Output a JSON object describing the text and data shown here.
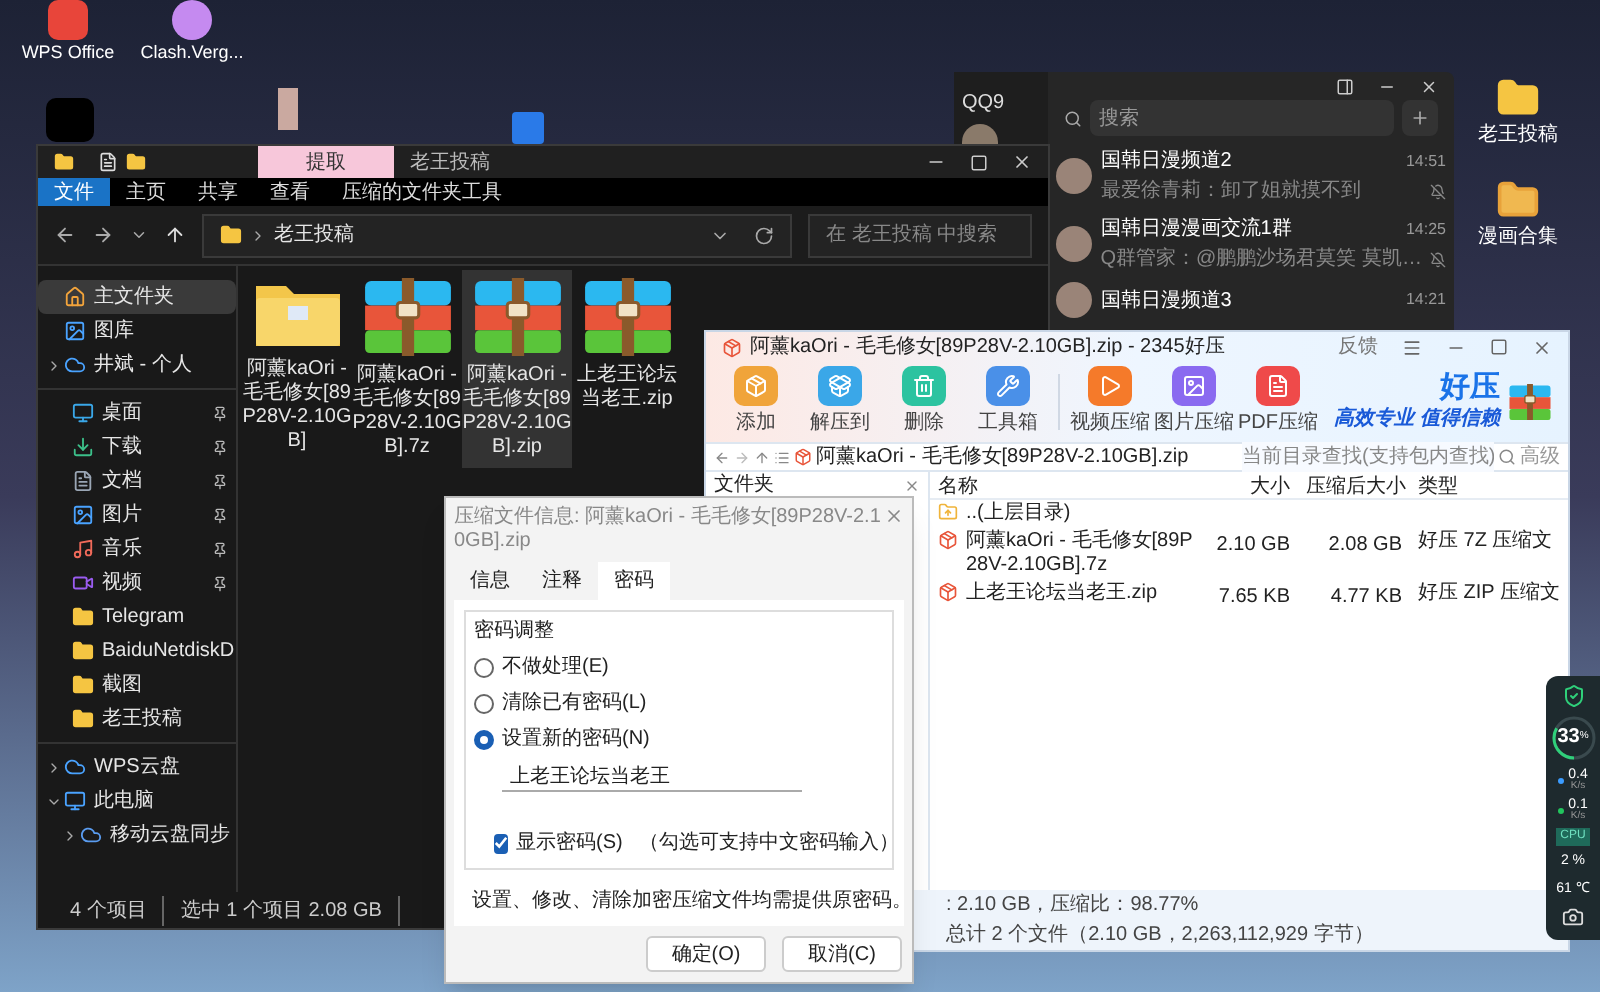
{
  "desktop": {
    "left_icons": [
      {
        "label": "WPS Office",
        "kind": "wps"
      },
      {
        "label": "Clash.Verg...",
        "kind": "clash"
      }
    ],
    "right_icons": [
      {
        "label": "老王投稿",
        "kind": "folder"
      },
      {
        "label": "漫画合集",
        "kind": "folder_red"
      }
    ]
  },
  "qq": {
    "app_name": "QQ9",
    "search": {
      "placeholder": "搜索"
    },
    "chats": [
      {
        "name": "国韩日漫频道2",
        "time": "14:51",
        "preview": "最爱徐青莉：卸了姐就摸不到",
        "muted": true
      },
      {
        "name": "国韩日漫漫画交流1群",
        "time": "14:25",
        "preview": "Q群管家：@鹏鹏沙场君莫笑 莫凯…",
        "muted": true
      },
      {
        "name": "国韩日漫频道3",
        "time": "14:21",
        "muted": false
      }
    ]
  },
  "explorer": {
    "context_tab": "提取",
    "title": "老王投稿",
    "ribbon_tabs": [
      {
        "label": "文件",
        "selected": true
      },
      {
        "label": "主页",
        "selected": false
      },
      {
        "label": "共享",
        "selected": false
      },
      {
        "label": "查看",
        "selected": false
      },
      {
        "label": "压缩的文件夹工具",
        "selected": false
      }
    ],
    "breadcrumb": "老王投稿",
    "search": {
      "placeholder": "在 老王投稿 中搜索"
    },
    "sidebar_groups": [
      {
        "items": [
          {
            "label": "主文件夹",
            "kind": "home",
            "selected": true,
            "pinned": false
          },
          {
            "label": "图库",
            "kind": "gallery",
            "selected": false,
            "pinned": false
          },
          {
            "label": "井斌 - 个人",
            "kind": "cloud",
            "selected": false,
            "pinned": false,
            "expanded": false
          }
        ]
      },
      {
        "items": [
          {
            "label": "桌面",
            "kind": "desktop",
            "selected": false,
            "pinned": true
          },
          {
            "label": "下载",
            "kind": "downloads",
            "selected": false,
            "pinned": true
          },
          {
            "label": "文档",
            "kind": "documents",
            "selected": false,
            "pinned": true
          },
          {
            "label": "图片",
            "kind": "pictures",
            "selected": false,
            "pinned": true
          },
          {
            "label": "音乐",
            "kind": "music",
            "selected": false,
            "pinned": true
          },
          {
            "label": "视频",
            "kind": "videos",
            "selected": false,
            "pinned": true
          },
          {
            "label": "Telegram",
            "kind": "folder",
            "selected": false,
            "pinned": false
          },
          {
            "label": "BaiduNetdiskD",
            "kind": "folder",
            "selected": false,
            "pinned": false
          },
          {
            "label": "截图",
            "kind": "folder",
            "selected": false,
            "pinned": false
          },
          {
            "label": "老王投稿",
            "kind": "folder",
            "selected": false,
            "pinned": false
          }
        ]
      },
      {
        "items": [
          {
            "label": "WPS云盘",
            "kind": "cloud",
            "selected": false,
            "pinned": false,
            "expanded": false
          },
          {
            "label": "此电脑",
            "kind": "pc",
            "selected": false,
            "pinned": false,
            "expanded": true,
            "children": [
              {
                "label": "移动云盘同步",
                "kind": "sync",
                "selected": false,
                "pinned": false,
                "expanded": false
              }
            ]
          }
        ]
      }
    ],
    "files": [
      {
        "name": "阿薰kaOri - 毛毛修女[89P28V-2.10GB]",
        "kind": "folder",
        "selected": false
      },
      {
        "name": "阿薰kaOri - 毛毛修女[89P28V-2.10GB].7z",
        "kind": "archive",
        "selected": false
      },
      {
        "name": "阿薰kaOri - 毛毛修女[89P28V-2.10GB].zip",
        "kind": "archive",
        "selected": true
      },
      {
        "name": "上老王论坛当老王.zip",
        "kind": "archive",
        "selected": false
      }
    ],
    "status": [
      "4 个项目",
      "选中 1 个项目  2.08 GB"
    ]
  },
  "zip_window": {
    "title": "阿薰kaOri - 毛毛修女[89P28V-2.10GB].zip - 2345好压",
    "feedback": "反馈",
    "toolbar": [
      {
        "label": "添加",
        "kind": "add"
      },
      {
        "label": "解压到",
        "kind": "extract"
      },
      {
        "label": "删除",
        "kind": "delete"
      },
      {
        "label": "工具箱",
        "kind": "toolbox"
      },
      {
        "label": "视频压缩",
        "kind": "video"
      },
      {
        "label": "图片压缩",
        "kind": "image"
      },
      {
        "label": "PDF压缩",
        "kind": "pdf"
      }
    ],
    "brand": "好压",
    "slogan": "高效专业 值得信赖",
    "path": "阿薰kaOri - 毛毛修女[89P28V-2.10GB].zip",
    "search": {
      "placeholder": "当前目录查找(支持包内查找)"
    },
    "advanced": "高级",
    "folder_pane_title": "文件夹",
    "columns": [
      "名称",
      "大小",
      "压缩后大小",
      "类型"
    ],
    "rows": [
      {
        "kind": "parent",
        "name": "..(上层目录)",
        "size": "",
        "packed": "",
        "type": ""
      },
      {
        "kind": "archive",
        "name": "阿薰kaOri - 毛毛修女[89P28V-2.10GB].7z",
        "size": "2.10 GB",
        "packed": "2.08 GB",
        "type": "好压 7Z 压缩文"
      },
      {
        "kind": "archive",
        "name": "上老王论坛当老王.zip",
        "size": "7.65 KB",
        "packed": "4.77 KB",
        "type": "好压 ZIP 压缩文"
      }
    ],
    "status_left": ": 2.10 GB，压缩比：98.77%",
    "status_right": "总计 2 个文件（2.10 GB，2,263,112,929 字节）"
  },
  "dialog": {
    "title": "压缩文件信息: 阿薰kaOri - 毛毛修女[89P28V-2.10GB].zip",
    "tabs": [
      {
        "label": "信息",
        "selected": false
      },
      {
        "label": "注释",
        "selected": false
      },
      {
        "label": "密码",
        "selected": true
      }
    ],
    "group_title": "密码调整",
    "options": [
      {
        "label": "不做处理(E)",
        "selected": false
      },
      {
        "label": "清除已有密码(L)",
        "selected": false
      },
      {
        "label": "设置新的密码(N)",
        "selected": true
      }
    ],
    "password": "上老王论坛当老王",
    "show_password": {
      "label": "显示密码(S)",
      "checked": true
    },
    "hint": "（勾选可支持中文密码输入）",
    "note": "设置、修改、清除加密压缩文件均需提供原密码。",
    "buttons": [
      "确定(O)",
      "取消(C)"
    ]
  },
  "monitor": {
    "value": "33",
    "unit": "%",
    "level": 0.33,
    "rates": [
      {
        "value": "0.4",
        "unit": "K/s",
        "color": "#3b9cff"
      },
      {
        "value": "0.1",
        "unit": "K/s",
        "color": "#22c55e"
      }
    ],
    "cpu_label": "CPU",
    "cpu": "2 %",
    "temp": "61 ℃"
  }
}
